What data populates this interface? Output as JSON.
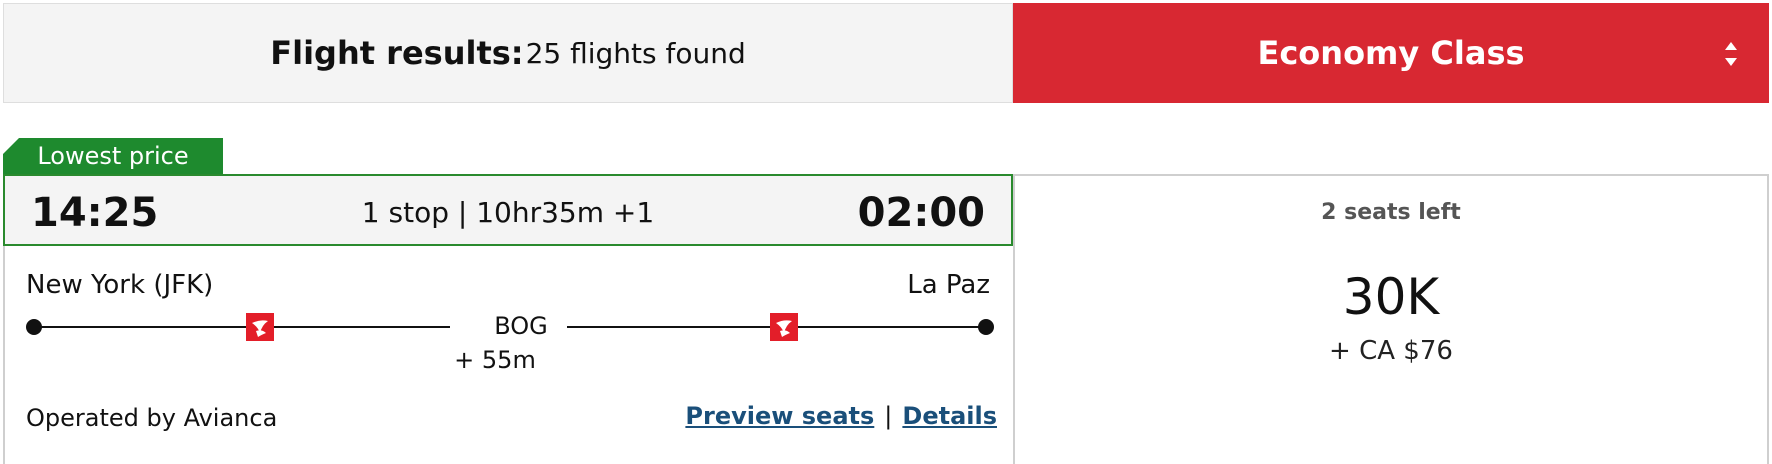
{
  "header": {
    "results_label": "Flight results:",
    "results_count": "25 flights found",
    "cabin_class": "Economy Class",
    "cabin_icon": "sort-arrows-icon"
  },
  "flight": {
    "badge": "Lowest price",
    "departure_time": "14:25",
    "arrival_time": "02:00",
    "summary": "1 stop | 10hr35m +1",
    "origin": "New York (JFK)",
    "destination": "La Paz",
    "stop_code": "BOG",
    "layover": "+ 55m",
    "operator": "Operated by Avianca",
    "preview_seats": "Preview seats",
    "details": "Details",
    "separator": "|",
    "airline_icon": "avianca-logo-icon",
    "brand_color": "#e31e29"
  },
  "fare": {
    "seats_left": "2 seats left",
    "points": "30K",
    "cash": "+ CA $76"
  },
  "colors": {
    "accent": "#d82832",
    "badge_green": "#1e8a2e",
    "link": "#1a4f7a"
  }
}
